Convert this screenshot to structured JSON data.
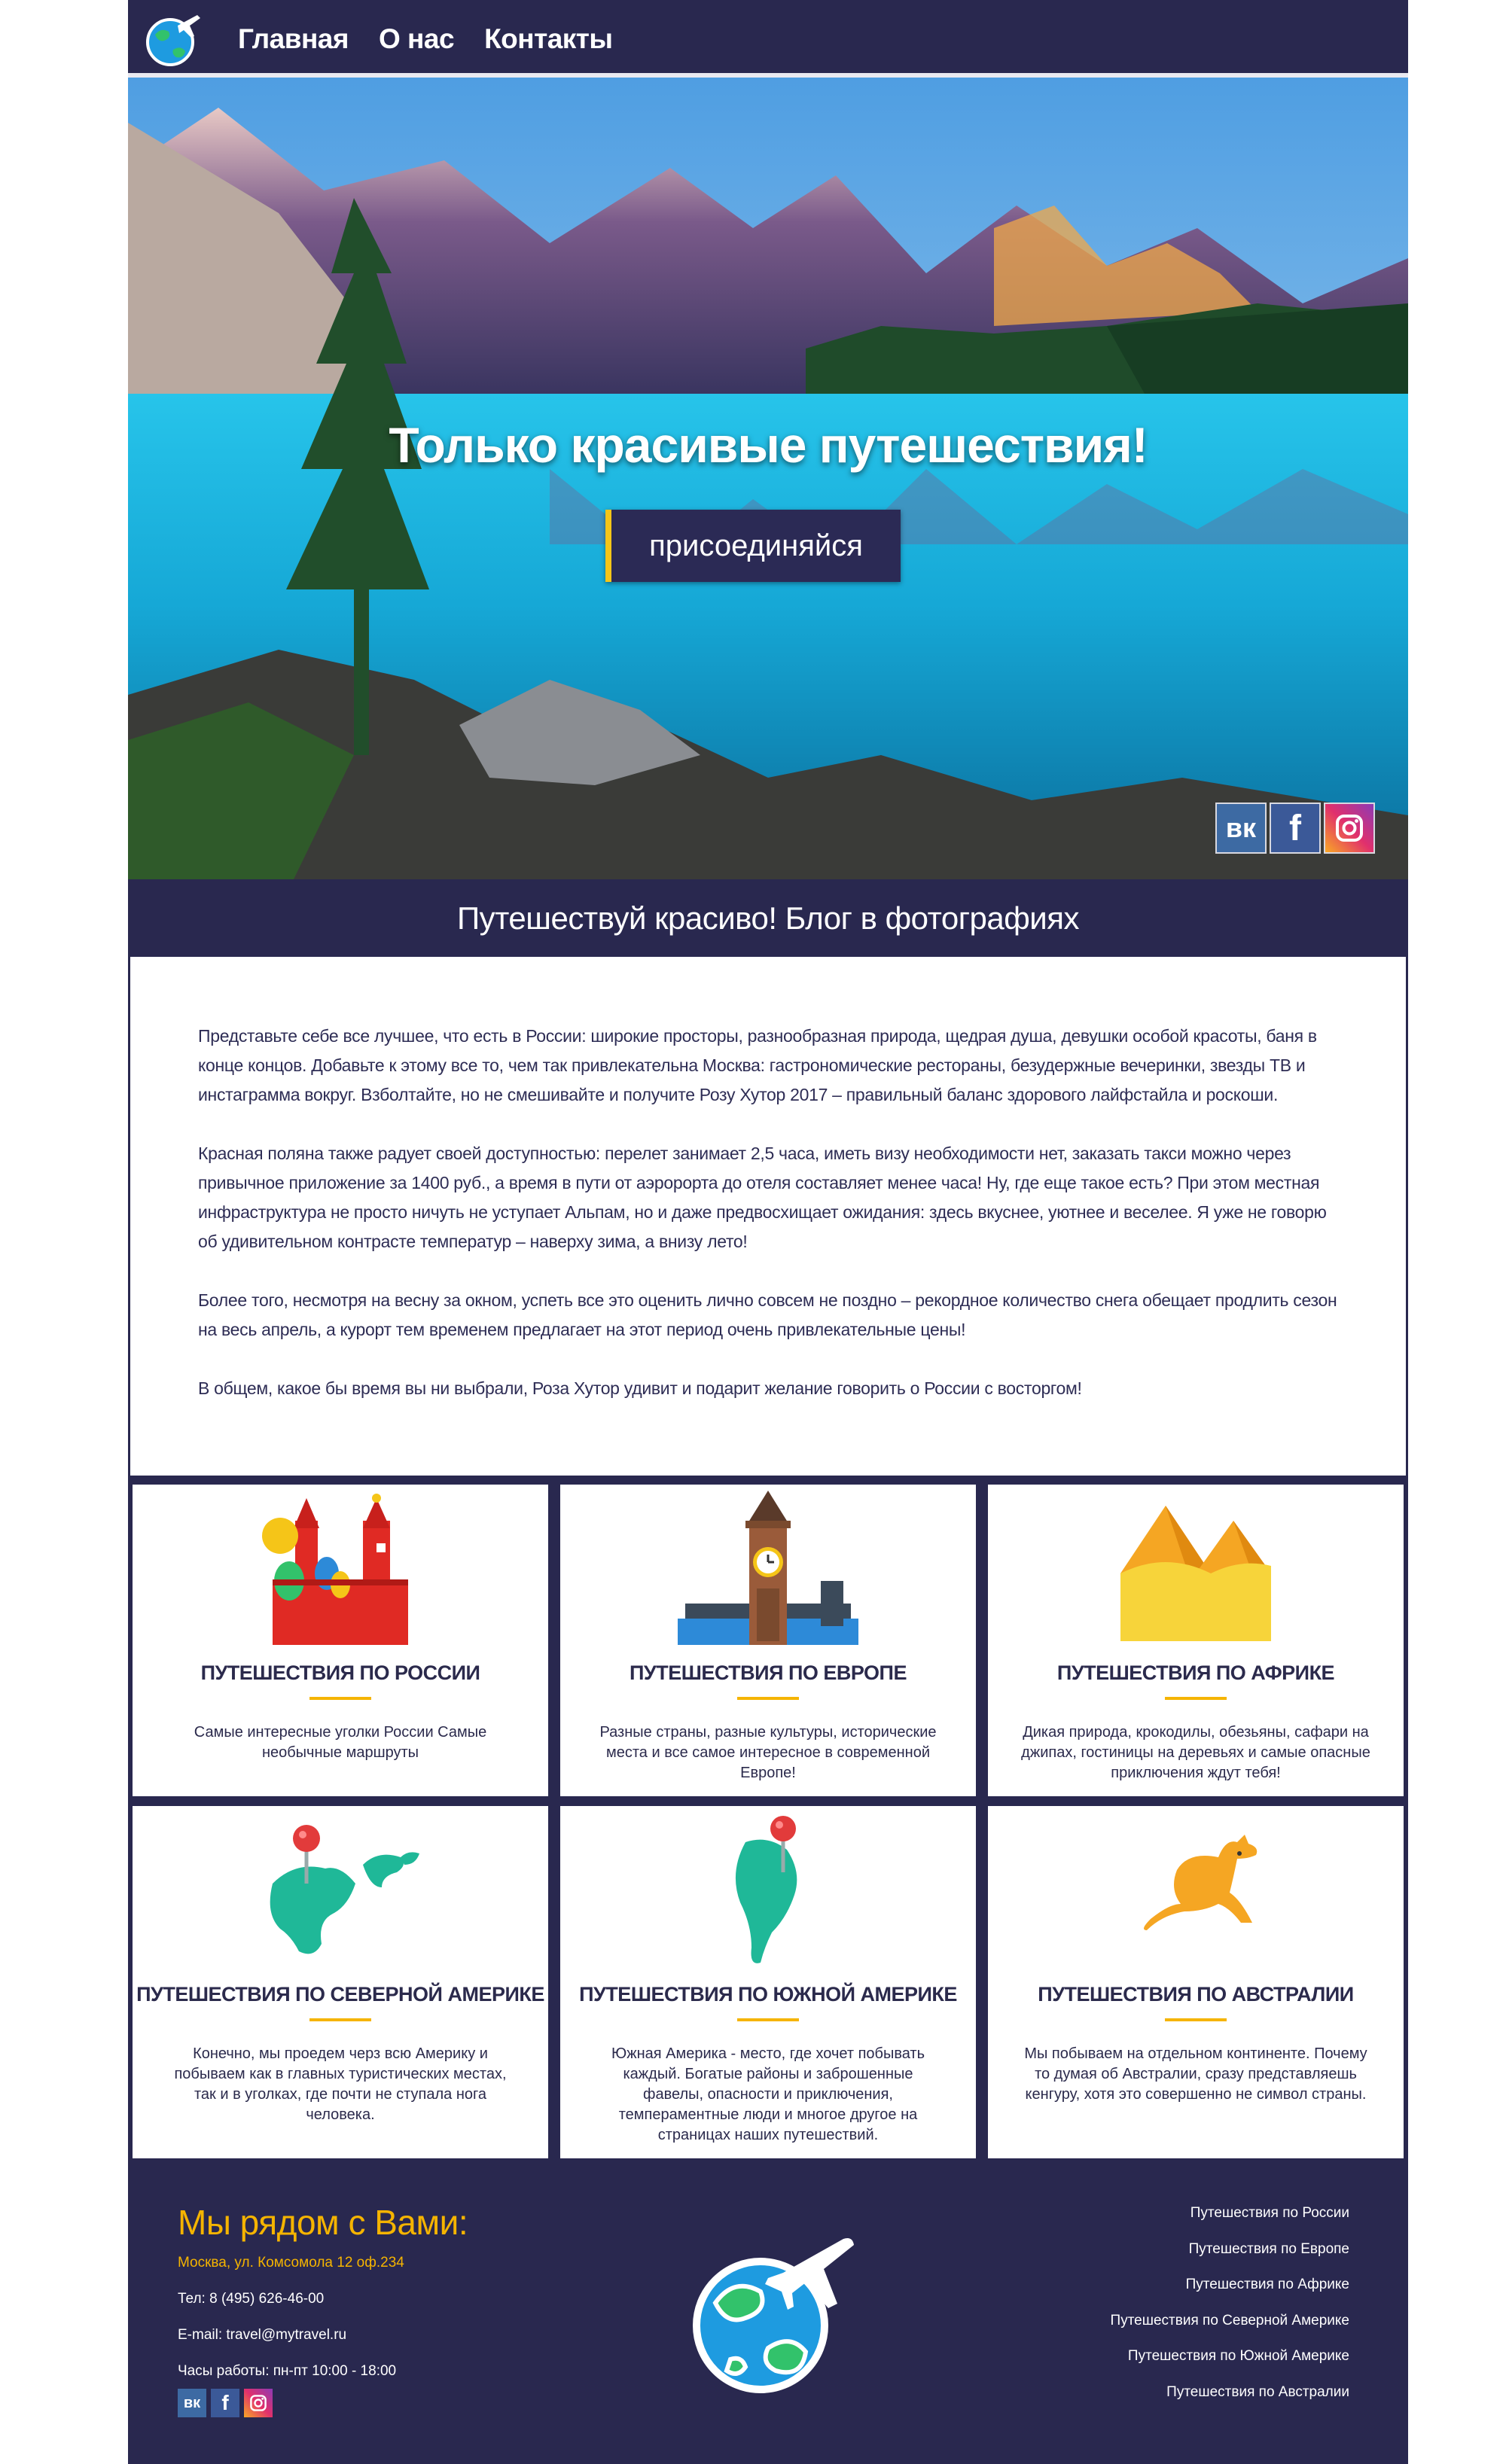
{
  "nav": {
    "items": [
      "Главная",
      "О нас",
      "Контакты"
    ]
  },
  "hero": {
    "title": "Только красивые путешествия!",
    "button": "присоединяйся"
  },
  "social": {
    "vk": "вк",
    "fb": "f",
    "ig": ""
  },
  "blog": {
    "heading": "Путешествуй красиво! Блог в фотографиях",
    "paragraphs": [
      "Представьте себе все лучшее, что есть в России: широкие просторы, разнообразная природа, щедрая душа, девушки особой красоты, баня в конце концов. Добавьте к этому все то, чем так привлекательна Москва: гастрономические рестораны, безудержные вечеринки, звезды ТВ и инстаграмма вокруг. Взболтайте, но не смешивайте и получите Розу Хутор 2017 – правильный баланс здорового лайфстайла и роскоши.",
      "Красная поляна также радует своей доступностью: перелет занимает 2,5 часа, иметь визу необходимости нет, заказать такси можно через привычное приложение за 1400 руб., а время в пути от аэророрта до отеля составляет менее часа! Ну, где еще такое есть? При этом местная инфраструктура не просто ничуть не уступает Альпам, но и даже предвосхищает ожидания: здесь вкуснее, уютнее и веселее. Я уже не говорю об удивительном контрасте температур – наверху зима, а внизу лето!",
      "Более того, несмотря на весну за окном, успеть все это оценить лично совсем не поздно – рекордное количество снега обещает продлить сезон на весь апрель, а курорт тем временем предлагает на этот период очень привлекательные цены!",
      "В общем, какое бы время вы ни выбрали, Роза Хутор удивит и подарит желание говорить о России с восторгом!"
    ]
  },
  "cards": [
    {
      "title": "ПУТЕШЕСТВИЯ ПО РОССИИ",
      "text": "Самые интересные уголки России Самые необычные маршруты",
      "icon": "kremlin-icon"
    },
    {
      "title": "ПУТЕШЕСТВИЯ ПО ЕВРОПЕ",
      "text": "Разные страны, разные культуры, исторические места и все самое интересное в современной Европе!",
      "icon": "big-ben-icon"
    },
    {
      "title": "ПУТЕШЕСТВИЯ ПО АФРИКЕ",
      "text": "Дикая природа, крокодилы, обезьяны, сафари на джипах, гостиницы на деревьях и самые опасные приключения ждут тебя!",
      "icon": "pyramids-icon"
    },
    {
      "title": "ПУТЕШЕСТВИЯ ПО СЕВЕРНОЙ АМЕРИКЕ",
      "text": "Конечно, мы проедем черз всю Америку и побываем как в главных туристических местах, так и в уголках, где почти не ступала нога человека.",
      "icon": "north-america-map-icon"
    },
    {
      "title": "ПУТЕШЕСТВИЯ ПО ЮЖНОЙ АМЕРИКЕ",
      "text": "Южная Америка - место, где хочет побывать каждый. Богатые районы и заброшенные фавелы, опасности и приключения, темпераментные люди и многое другое на страницах наших путешествий.",
      "icon": "south-america-map-icon"
    },
    {
      "title": "ПУТЕШЕСТВИЯ ПО АВСТРАЛИИ",
      "text": "Мы побываем на отдельном континенте. Почему то думая об Австралии, сразу представляешь кенгуру, хотя это совершенно не символ страны.",
      "icon": "kangaroo-icon"
    }
  ],
  "footer": {
    "title": "Мы рядом с Вами:",
    "address": "Москва, ул. Комсомола 12 оф.234",
    "phone": "Тел: 8 (495) 626-46-00",
    "email": "E-mail: travel@mytravel.ru",
    "hours": "Часы работы: пн-пт 10:00 - 18:00",
    "links": [
      "Путешествия по России",
      "Путешествия по Европе",
      "Путешествия по Африке",
      "Путешествия по Северной Америке",
      "Путешествия по Южной Америке",
      "Путешествия по Австралии"
    ]
  },
  "colors": {
    "navy": "#29284f",
    "accent": "#f5b400"
  }
}
